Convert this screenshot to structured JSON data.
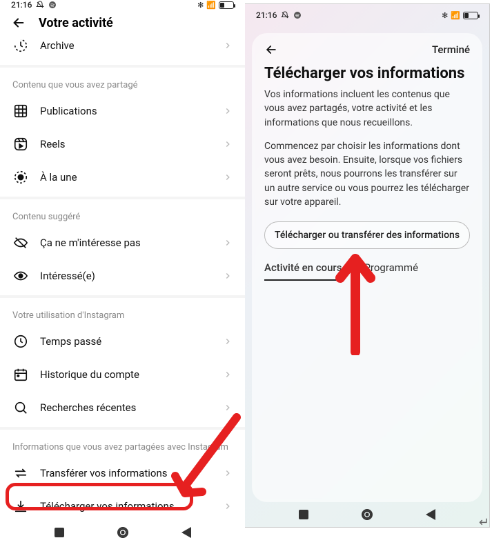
{
  "left": {
    "status": {
      "time": "21:16",
      "battery": "30"
    },
    "header_title": "Votre activité",
    "archive_label": "Archive",
    "sections": {
      "shared": {
        "title": "Contenu que vous avez partagé",
        "items": {
          "publications": "Publications",
          "reels": "Reels",
          "highlights": "À la une"
        }
      },
      "suggested": {
        "title": "Contenu suggéré",
        "items": {
          "not_interested": "Ça ne m'intéresse pas",
          "interested": "Intéressé(e)"
        }
      },
      "usage": {
        "title": "Votre utilisation d'Instagram",
        "items": {
          "time_spent": "Temps passé",
          "account_history": "Historique du compte",
          "recent_searches": "Recherches récentes"
        }
      },
      "info_shared": {
        "title": "Informations que vous avez partagées avec Instagram",
        "items": {
          "transfer": "Transférer vos informations",
          "download": "Télécharger vos informations"
        }
      }
    }
  },
  "right": {
    "status": {
      "time": "21:16",
      "battery": "30"
    },
    "done_label": "Terminé",
    "title": "Télécharger vos informations",
    "para1": "Vos informations incluent les contenus que vous avez partagés, votre activité et les informations que nous recueillons.",
    "para2": "Commencez par choisir les informations dont vous avez besoin. Ensuite, lorsque vos fichiers seront prêts, nous pourrons les transférer sur un autre service ou vous pourrez les télécharger sur votre appareil.",
    "button_label": "Télécharger ou transférer des informations",
    "tabs": {
      "current": "Activité en cours",
      "scheduled": "Programmé"
    }
  }
}
